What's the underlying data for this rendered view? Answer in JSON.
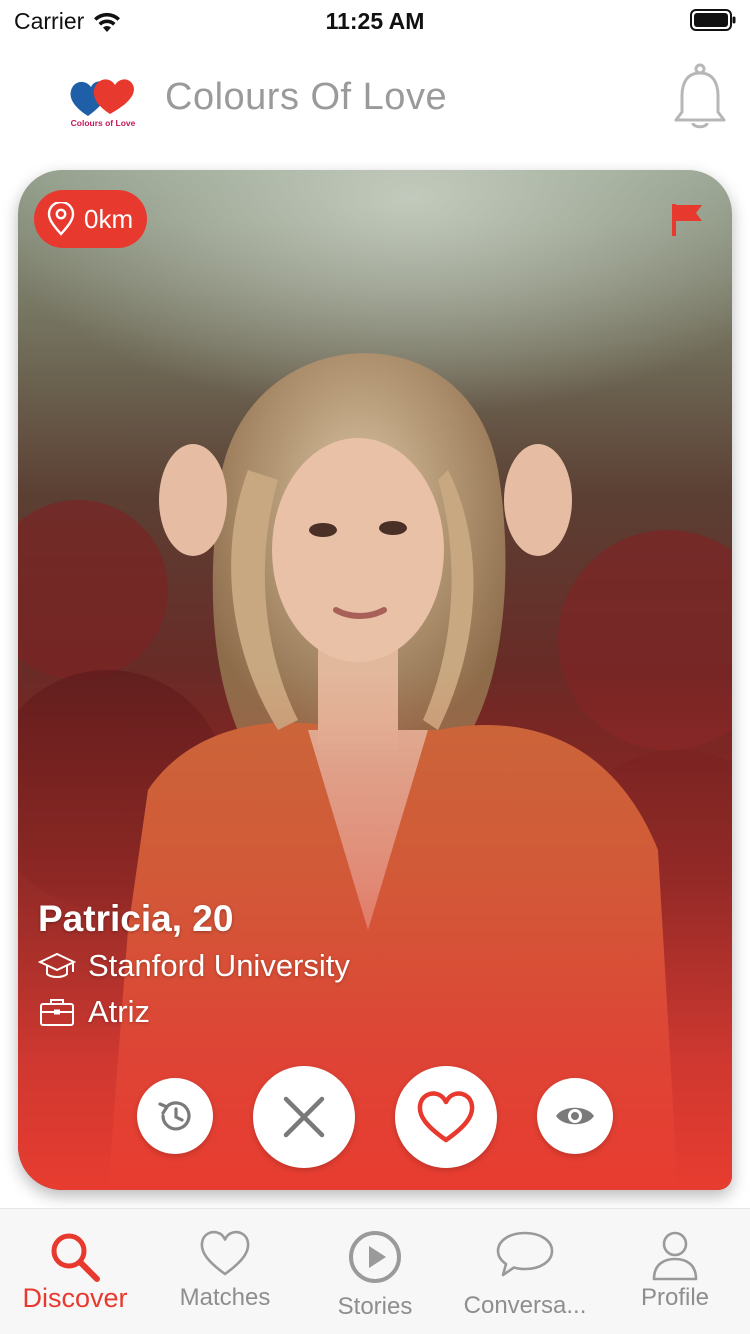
{
  "status_bar": {
    "carrier": "Carrier",
    "time": "11:25 AM"
  },
  "header": {
    "title": "Colours Of Love",
    "logo_text": "Colours of Love",
    "notification_icon": "bell-icon"
  },
  "card": {
    "distance": "0km",
    "name_age": "Patricia, 20",
    "school": "Stanford University",
    "job": "Atriz",
    "report_icon": "flag-icon"
  },
  "actions": [
    {
      "name": "rewind",
      "icon": "history-icon"
    },
    {
      "name": "dislike",
      "icon": "close-icon"
    },
    {
      "name": "like",
      "icon": "heart-icon"
    },
    {
      "name": "view",
      "icon": "eye-icon"
    }
  ],
  "tabs": [
    {
      "label": "Discover",
      "icon": "search-icon",
      "active": true
    },
    {
      "label": "Matches",
      "icon": "heart-outline-icon",
      "active": false
    },
    {
      "label": "Stories",
      "icon": "play-circle-icon",
      "active": false
    },
    {
      "label": "Conversa...",
      "icon": "chat-bubble-icon",
      "active": false
    },
    {
      "label": "Profile",
      "icon": "person-icon",
      "active": false
    }
  ],
  "colors": {
    "accent": "#e8392f",
    "title_gray": "#9a9a9a",
    "tab_inactive": "#8e8e8e",
    "tab_bar_bg": "#f7f7f7"
  }
}
